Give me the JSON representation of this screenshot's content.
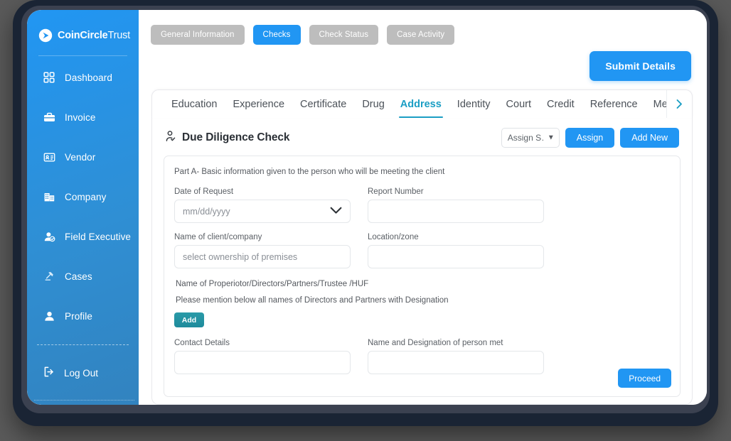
{
  "brand": {
    "name_bold": "CoinCircle",
    "name_light": "Trust",
    "logo_icon": "play-arrow-logo-icon"
  },
  "sidebar": {
    "items": [
      {
        "label": "Dashboard",
        "icon": "grid-squares-icon"
      },
      {
        "label": "Invoice",
        "icon": "briefcase-icon"
      },
      {
        "label": "Vendor",
        "icon": "id-card-icon"
      },
      {
        "label": "Company",
        "icon": "office-building-icon"
      },
      {
        "label": "Field Executive",
        "icon": "user-check-icon"
      },
      {
        "label": "Cases",
        "icon": "gavel-icon"
      },
      {
        "label": "Profile",
        "icon": "user-icon"
      }
    ],
    "logout": {
      "label": "Log Out",
      "icon": "logout-arrow-icon"
    }
  },
  "topbar": {
    "pills": [
      {
        "label": "General Information",
        "active": false
      },
      {
        "label": "Checks",
        "active": true
      },
      {
        "label": "Check Status",
        "active": false
      },
      {
        "label": "Case Activity",
        "active": false
      }
    ],
    "submit_label": "Submit Details"
  },
  "tabbar": {
    "tabs": [
      {
        "label": "Education",
        "active": false
      },
      {
        "label": "Experience",
        "active": false
      },
      {
        "label": "Certificate",
        "active": false
      },
      {
        "label": "Drug",
        "active": false
      },
      {
        "label": "Address",
        "active": true
      },
      {
        "label": "Identity",
        "active": false
      },
      {
        "label": "Court",
        "active": false
      },
      {
        "label": "Credit",
        "active": false
      },
      {
        "label": "Reference",
        "active": false
      },
      {
        "label": "Media",
        "active": false
      }
    ],
    "next_icon": "chevron-right-icon"
  },
  "card": {
    "title": "Due Diligence Check",
    "title_icon": "user-check-icon",
    "assign_select": {
      "value": "Assign S…",
      "options": [
        "Assign S…"
      ]
    },
    "assign_button": "Assign",
    "add_new_button": "Add New"
  },
  "form": {
    "part_note": "Part A- Basic information given to the person who will be meeting the client",
    "fields": {
      "date_of_request": {
        "label": "Date of Request",
        "placeholder": "mm/dd/yyyy",
        "value": ""
      },
      "report_number": {
        "label": "Report Number",
        "placeholder": "",
        "value": ""
      },
      "client_company": {
        "label": "Name of client/company",
        "placeholder": "select ownership of premises",
        "value": ""
      },
      "location_zone": {
        "label": "Location/zone",
        "placeholder": "",
        "value": ""
      },
      "contact_details": {
        "label": "Contact Details",
        "placeholder": "",
        "value": ""
      },
      "person_met": {
        "label": "Name and Designation of person met",
        "placeholder": "",
        "value": ""
      }
    },
    "proprietor_heading": "Name of  Properiotor/Directors/Partners/Trustee /HUF",
    "proprietor_subtext": "Please mention below all names of Directors and Partners  with Designation",
    "add_button": "Add",
    "proceed_button": "Proceed"
  },
  "colors": {
    "brand_blue": "#2196f3",
    "sidebar_gradient_start": "#2196f3",
    "sidebar_gradient_end": "#3283bf",
    "active_tab_teal": "#1b9ec4",
    "add_button_teal": "#1e8b9c",
    "pill_inactive_gray": "#bdbdbd",
    "device_frame": "#1a2434",
    "page_background": "#5a5a5a"
  }
}
